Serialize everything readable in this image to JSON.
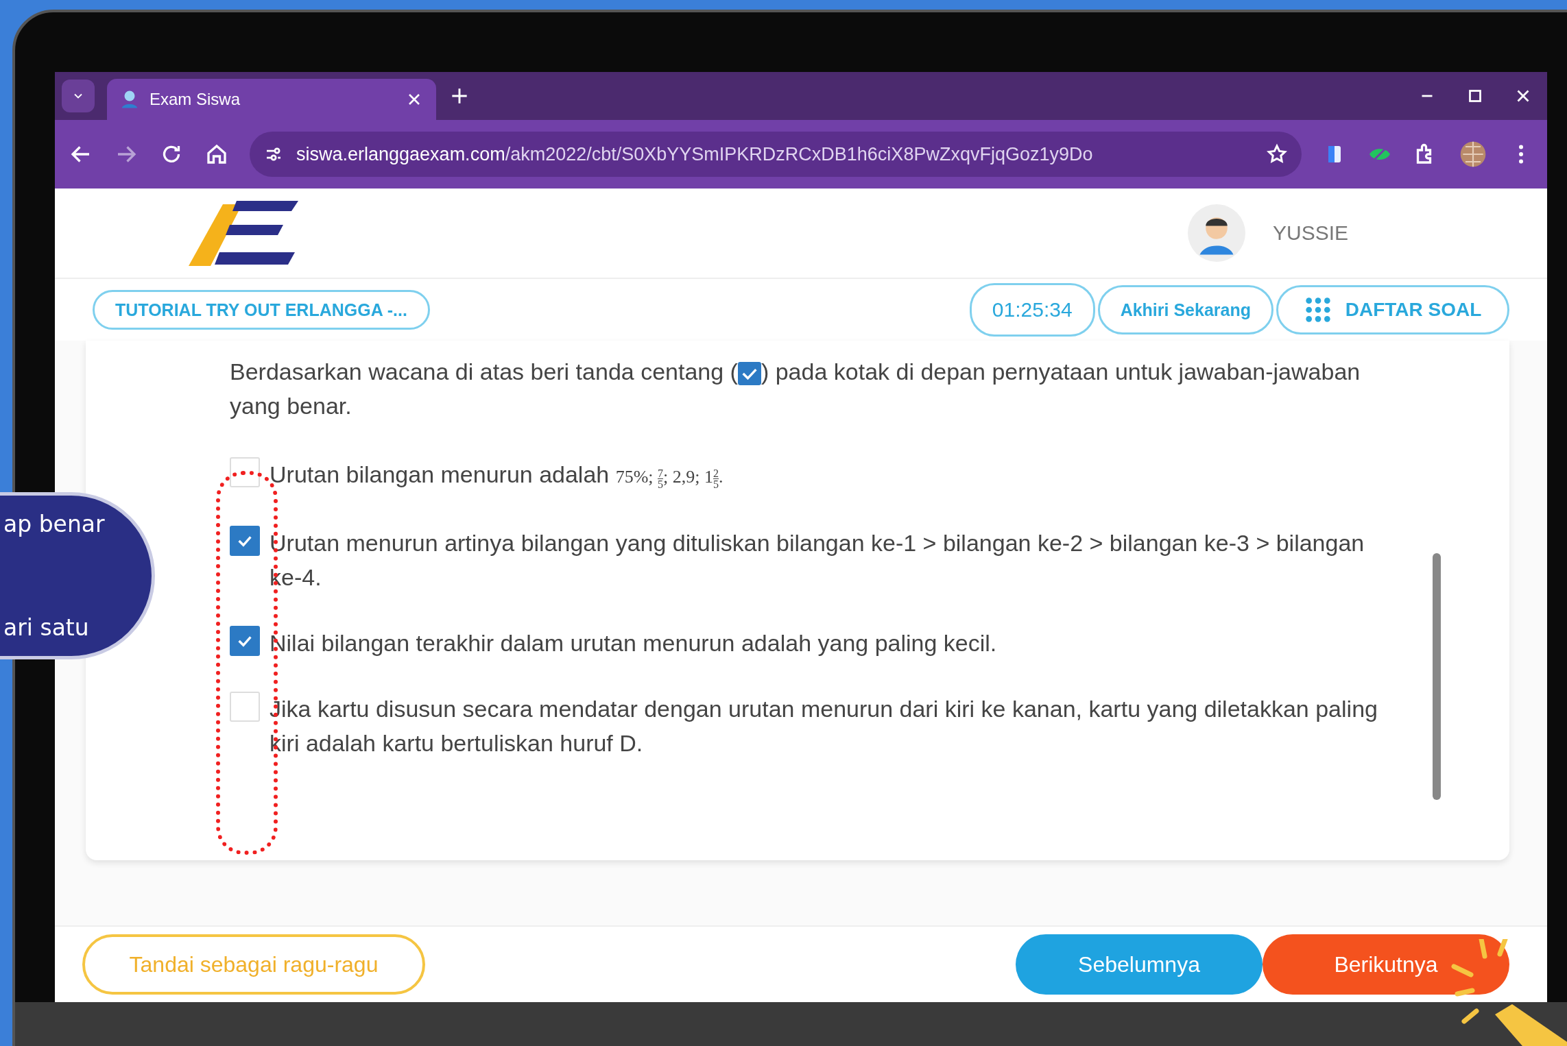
{
  "browser": {
    "tab": {
      "title": "Exam Siswa",
      "selected": true
    },
    "url_host": "siswa.erlanggaexam.com",
    "url_path": "/akm2022/cbt/S0XbYYSmIPKRDzRCxDB1h6ciX8PwZxqvFjqGoz1y9Do"
  },
  "header": {
    "user_name": "YUSSIE"
  },
  "toolbar": {
    "exam_title": "TUTORIAL TRY OUT ERLANGGA -...",
    "timer": "01:25:34",
    "end_button": "Akhiri Sekarang",
    "question_list_button": "DAFTAR SOAL"
  },
  "question": {
    "prompt_before": "Berdasarkan wacana di atas beri tanda centang (",
    "prompt_after": ") pada kotak di depan pernyataan untuk jawaban-jawaban",
    "prompt_line2": "yang benar.",
    "options": [
      {
        "checked": false,
        "text": "Urutan bilangan menurun adalah",
        "math": [
          {
            "kind": "text",
            "text": "75%;"
          },
          {
            "kind": "frac",
            "num": "7",
            "den": "5",
            "after": ";"
          },
          {
            "kind": "text",
            "text": "2,9;"
          },
          {
            "kind": "mixed",
            "whole": "1",
            "num": "2",
            "den": "5",
            "after": "."
          }
        ]
      },
      {
        "checked": true,
        "text": "Urutan menurun artinya bilangan yang dituliskan bilangan ke-1 > bilangan ke-2 > bilangan ke-3 > bilangan ke-4."
      },
      {
        "checked": true,
        "text": "Nilai bilangan terakhir dalam urutan menurun adalah yang paling kecil."
      },
      {
        "checked": false,
        "text": "Jika kartu disusun secara mendatar dengan urutan menurun dari kiri ke kanan, kartu yang diletakkan paling kiri adalah kartu bertuliskan huruf D."
      }
    ]
  },
  "footer": {
    "doubt_button": "Tandai sebagai ragu-ragu",
    "prev_button": "Sebelumnya",
    "next_button": "Berikutnya"
  },
  "callout": {
    "line1": "ap benar",
    "line2": "ari satu"
  }
}
